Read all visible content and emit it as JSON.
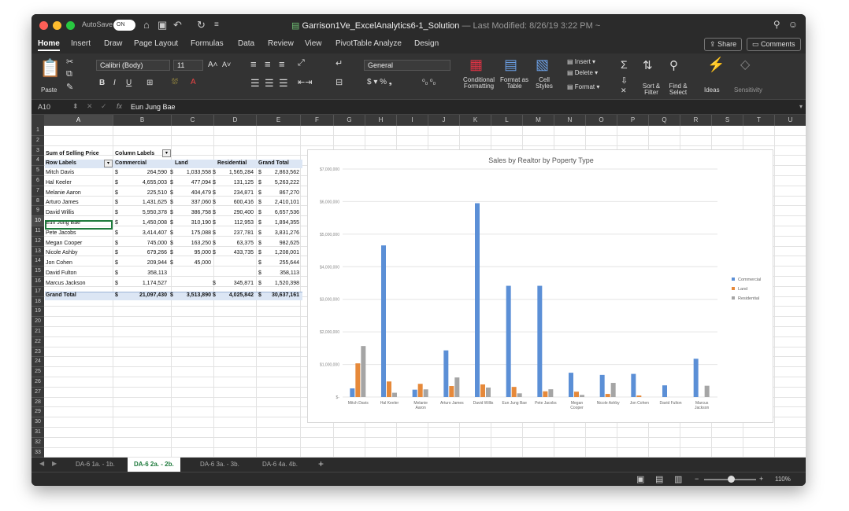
{
  "titlebar": {
    "autosave_label": "AutoSave",
    "autosave_state": "ON",
    "doc_title": "Garrison1Ve_ExcelAnalytics6-1_Solution",
    "last_modified": " — Last Modified: 8/26/19 3:22 PM ~"
  },
  "ribbon_tabs": [
    "Home",
    "Insert",
    "Draw",
    "Page Layout",
    "Formulas",
    "Data",
    "Review",
    "View",
    "PivotTable Analyze",
    "Design"
  ],
  "share_label": "Share",
  "comments_label": "Comments",
  "ribbon": {
    "paste": "Paste",
    "font_name": "Calibri (Body)",
    "font_size": "11",
    "number_format": "General",
    "conditional_formatting": "Conditional Formatting",
    "format_as_table": "Format as Table",
    "cell_styles": "Cell Styles",
    "insert": "Insert",
    "delete": "Delete",
    "format": "Format",
    "sort_filter": "Sort & Filter",
    "find_select": "Find & Select",
    "ideas": "Ideas",
    "sensitivity": "Sensitivity"
  },
  "formula_bar": {
    "name_box": "A10",
    "fx": "fx",
    "content": "Eun Jung Bae"
  },
  "columns": [
    "A",
    "B",
    "C",
    "D",
    "E",
    "F",
    "G",
    "H",
    "I",
    "J",
    "K",
    "L",
    "M",
    "N",
    "O",
    "P",
    "Q",
    "R",
    "S",
    "T",
    "U"
  ],
  "rows": [
    "1",
    "2",
    "3",
    "4",
    "5",
    "6",
    "7",
    "8",
    "9",
    "10",
    "11",
    "12",
    "13",
    "14",
    "15",
    "16",
    "17",
    "18",
    "19",
    "20",
    "21",
    "22",
    "23",
    "24",
    "25",
    "26",
    "27",
    "28",
    "29",
    "30",
    "31",
    "32",
    "33"
  ],
  "pivot": {
    "header_a3": "Sum of Selling Price",
    "header_b3": "Column Labels",
    "row_labels": "Row Labels",
    "col_headers": [
      "Commercial",
      "Land",
      "Residential",
      "Grand Total"
    ],
    "rows": [
      {
        "name": "Mitch Davis",
        "commercial": "264,590",
        "land": "1,033,558",
        "residential": "1,565,284",
        "total": "2,863,562"
      },
      {
        "name": "Hal Keeler",
        "commercial": "4,655,003",
        "land": "477,094",
        "residential": "131,125",
        "total": "5,263,222"
      },
      {
        "name": "Melanie Aaron",
        "commercial": "225,510",
        "land": "404,479",
        "residential": "234,871",
        "total": "867,270"
      },
      {
        "name": "Arturo James",
        "commercial": "1,431,625",
        "land": "337,060",
        "residential": "600,416",
        "total": "2,410,101"
      },
      {
        "name": "David Willis",
        "commercial": "5,950,378",
        "land": "386,758",
        "residential": "290,400",
        "total": "6,657,536"
      },
      {
        "name": "Eun Jung Bae",
        "commercial": "1,450,008",
        "land": "310,190",
        "residential": "112,953",
        "total": "1,894,355"
      },
      {
        "name": "Pete Jacobs",
        "commercial": "3,414,407",
        "land": "175,088",
        "residential": "237,781",
        "total": "3,831,276"
      },
      {
        "name": "Megan Cooper",
        "commercial": "745,000",
        "land": "163,250",
        "residential": "63,375",
        "total": "982,625"
      },
      {
        "name": "Nicole Ashby",
        "commercial": "679,266",
        "land": "95,000",
        "residential": "433,735",
        "total": "1,208,001"
      },
      {
        "name": "Jon Cohen",
        "commercial": "209,944",
        "land": "45,000",
        "residential": "",
        "total": "255,644"
      },
      {
        "name": "David Fulton",
        "commercial": "358,113",
        "land": "",
        "residential": "",
        "total": "358,113"
      },
      {
        "name": "Marcus Jackson",
        "commercial": "1,174,527",
        "land": "",
        "residential": "345,871",
        "total": "1,520,398"
      }
    ],
    "grand_total_label": "Grand Total",
    "grand_total": {
      "commercial": "21,097,430",
      "land": "3,513,890",
      "residential": "4,025,842",
      "total": "30,637,161"
    },
    "currency": "$"
  },
  "sheet_tabs": [
    "DA-6 1a. - 1b.",
    "DA-6 2a. - 2b.",
    "DA-6 3a. - 3b.",
    "DA-6 4a. 4b."
  ],
  "active_sheet_index": 1,
  "zoom": "110%",
  "colors": {
    "commercial": "#5b8fd6",
    "land": "#e6893a",
    "residential": "#a5a5a5",
    "excel_green": "#1e7a3c"
  },
  "chart_data": {
    "type": "bar",
    "title": "Sales by Realtor by Poperty Type",
    "categories": [
      "Mitch Davis",
      "Hal Keeler",
      "Melanie Aaron",
      "Arturo James",
      "David Willis",
      "Eun Jung Bae",
      "Pete Jacobs",
      "Megan Cooper",
      "Nicole Ashby",
      "Jon Cohen",
      "David Fulton",
      "Marcus Jackson"
    ],
    "category_lines": [
      [
        "Mitch Davis"
      ],
      [
        "Hal Keeler"
      ],
      [
        "Melanie",
        "Aaron"
      ],
      [
        "Arturo James"
      ],
      [
        "David Willis"
      ],
      [
        "Eun Jung Bae"
      ],
      [
        "Pete Jacobs"
      ],
      [
        "Megan",
        "Cooper"
      ],
      [
        "Nicole Ashby"
      ],
      [
        "Jon Cohen"
      ],
      [
        "David Fulton"
      ],
      [
        "Marcus",
        "Jackson"
      ]
    ],
    "series": [
      {
        "name": "Commercial",
        "values": [
          264590,
          4655003,
          225510,
          1431625,
          5950378,
          3414407,
          3414407,
          745000,
          679266,
          709944,
          358113,
          1174527
        ]
      },
      {
        "name": "Land",
        "values": [
          1033558,
          477094,
          404479,
          337060,
          386758,
          310190,
          175088,
          163250,
          95000,
          45000,
          0,
          0
        ]
      },
      {
        "name": "Residential",
        "values": [
          1565284,
          131125,
          234871,
          600416,
          290400,
          112953,
          237781,
          63375,
          433735,
          0,
          0,
          345871
        ]
      }
    ],
    "ylim": [
      0,
      7000000
    ],
    "yticks": [
      "$-",
      "$1,000,000",
      "$2,000,000",
      "$3,000,000",
      "$4,000,000",
      "$5,000,000",
      "$6,000,000",
      "$7,000,000"
    ],
    "legend": "right",
    "grid": true
  }
}
